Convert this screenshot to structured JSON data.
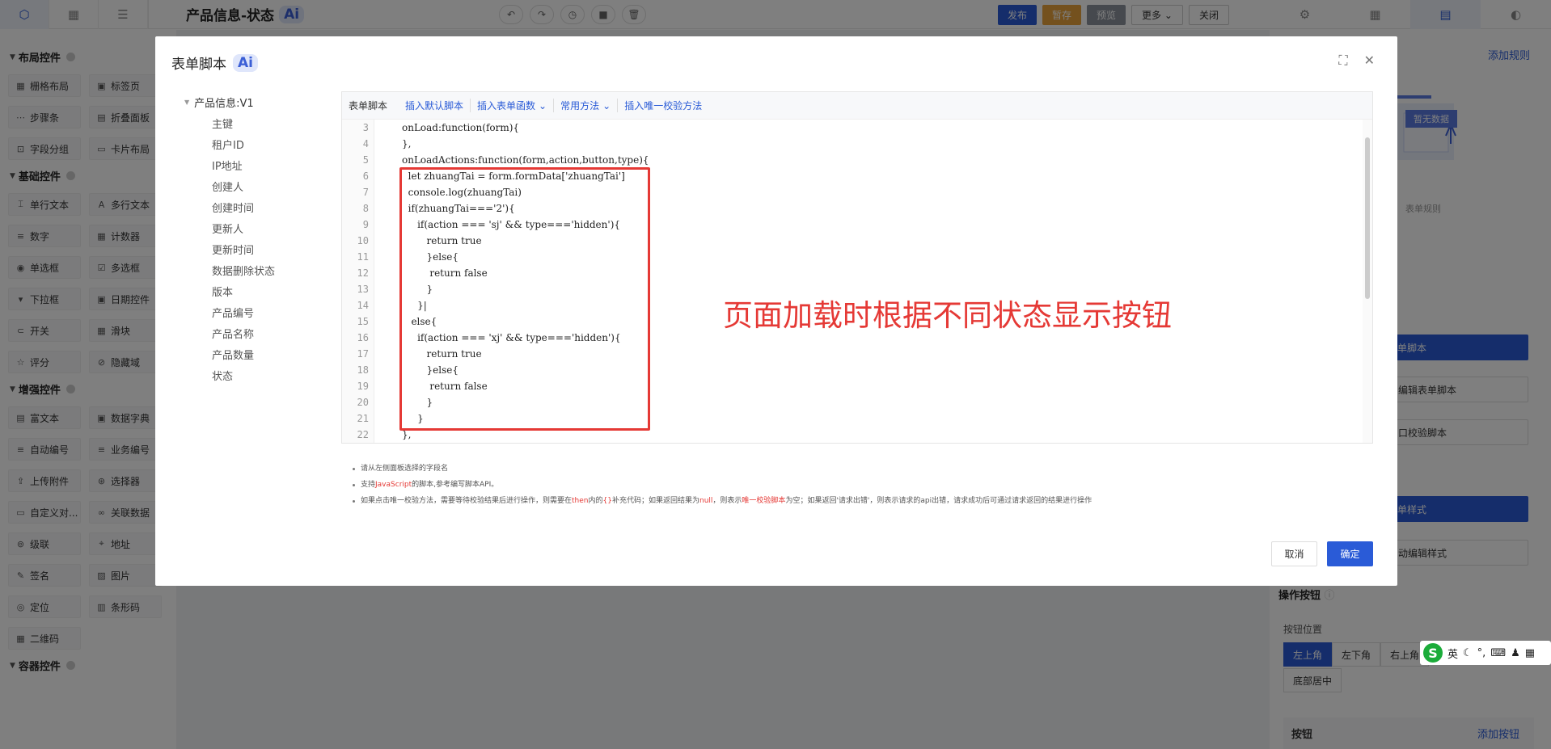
{
  "topbar": {
    "title": "产品信息-状态",
    "ai_badge": "Ai",
    "publish": "发布",
    "save_draft": "暂存",
    "preview": "预览",
    "more": "更多",
    "close": "关闭"
  },
  "sidebar": {
    "groups": [
      {
        "title": "布局控件",
        "items": [
          "栅格布局",
          "标签页",
          "步骤条",
          "折叠面板",
          "字段分组",
          "卡片布局"
        ]
      },
      {
        "title": "基础控件",
        "items": [
          "单行文本",
          "多行文本",
          "数字",
          "计数器",
          "单选框",
          "多选框",
          "下拉框",
          "日期控件",
          "开关",
          "滑块",
          "评分",
          "隐藏域"
        ]
      },
      {
        "title": "增强控件",
        "items": [
          "富文本",
          "数据字典",
          "自动编号",
          "业务编号",
          "上传附件",
          "选择器",
          "自定义对...",
          "关联数据",
          "级联",
          "地址",
          "签名",
          "图片",
          "定位",
          "条形码",
          "二维码"
        ]
      },
      {
        "title": "容器控件",
        "items": []
      }
    ]
  },
  "right_panel": {
    "add_rule": "添加规则",
    "empty": "暂无数据",
    "empty_tip": "表单规则",
    "btn1": "单脚本",
    "btn2": "编辑表单脚本",
    "btn3": "口校验脚本",
    "btn4": "单样式",
    "btn5": "动编辑样式",
    "section_ops": "操作按钮",
    "button_pos": "按钮位置",
    "pos_options": [
      "左上角",
      "左下角",
      "右上角"
    ],
    "pos_bottom_center": "底部居中",
    "buttons_label": "按钮",
    "add_button": "添加按钮"
  },
  "ime": {
    "logo": "S",
    "lang": "英"
  },
  "dialog": {
    "title": "表单脚本",
    "ai_badge": "Ai",
    "tree": {
      "root": "产品信息:V1",
      "fields": [
        "主键",
        "租户ID",
        "IP地址",
        "创建人",
        "创建时间",
        "更新人",
        "更新时间",
        "数据删除状态",
        "版本",
        "产品编号",
        "产品名称",
        "产品数量",
        "状态"
      ]
    },
    "toolbar": {
      "label": "表单脚本",
      "insert_default": "插入默认脚本",
      "insert_func": "插入表单函数",
      "common": "常用方法",
      "insert_unique": "插入唯一校验方法"
    },
    "code": {
      "line_numbers": [
        "3",
        "4",
        "5",
        "6",
        "7",
        "8",
        "9",
        "10",
        "11",
        "12",
        "13",
        "14",
        "15",
        "16",
        "17",
        "18",
        "19",
        "20",
        "21",
        "22"
      ],
      "lines": [
        "onLoad:function(form){",
        "},",
        "onLoadActions:function(form,action,button,type){",
        "  let zhuangTai = form.formData['zhuangTai']",
        "  console.log(zhuangTai)",
        "  if(zhuangTai==='2'){",
        "     if(action === 'sj' && type==='hidden'){",
        "        return true",
        "        }else{",
        "         return false",
        "        }",
        "     }|",
        "   else{",
        "     if(action === 'xj' && type==='hidden'){",
        "        return true",
        "        }else{",
        "         return false",
        "        }",
        "     }",
        "},"
      ]
    },
    "annotation": "页面加载时根据不同状态显示按钮",
    "tips": {
      "t1": "请从左侧面板选择的字段名",
      "t2a": "支持",
      "t2b": "JavaScript",
      "t2c": "的脚本,参考编写脚本API。",
      "t3a": "如果点击唯一校验方法，需要等待校验结果后进行操作，则需要在",
      "t3b": "then",
      "t3c": "内的",
      "t3d": "{}",
      "t3e": "补充代码；如果返回结果为",
      "t3f": "null",
      "t3g": "，则表示",
      "t3h": "唯一校验脚本",
      "t3i": "为空；如果返回'请求出错'，则表示请求的api出错，请求成功后可通过请求返回的结果进行操作"
    },
    "cancel": "取消",
    "ok": "确定"
  }
}
